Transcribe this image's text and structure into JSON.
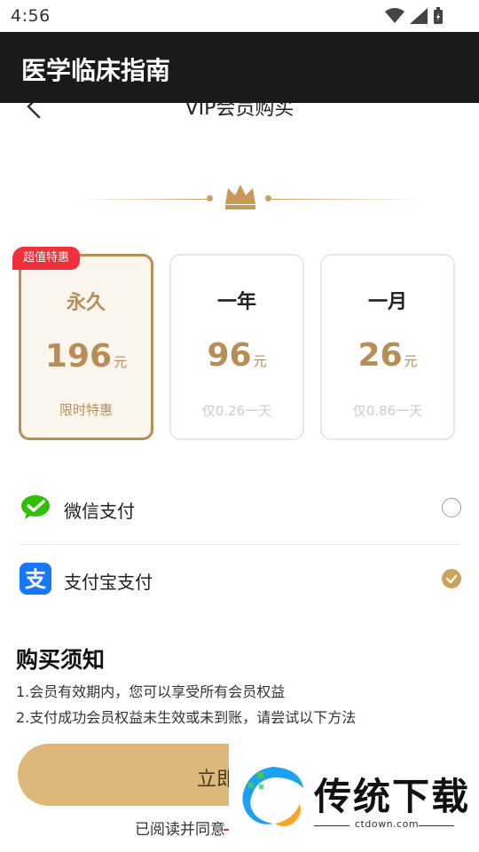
{
  "status_bar": {
    "time": "4:56"
  },
  "app_bar": {
    "title": "医学临床指南"
  },
  "page": {
    "title": "VIP会员购买"
  },
  "plans": [
    {
      "name": "永久",
      "price": "196",
      "unit": "元",
      "note": "限时特惠",
      "badge": "超值特惠",
      "selected": true
    },
    {
      "name": "一年",
      "price": "96",
      "unit": "元",
      "note": "仅0.26一天",
      "selected": false
    },
    {
      "name": "一月",
      "price": "26",
      "unit": "元",
      "note": "仅0.86一天",
      "selected": false
    }
  ],
  "payment": {
    "wechat": {
      "label": "微信支付",
      "checked": false
    },
    "alipay": {
      "label": "支付宝支付",
      "checked": true
    }
  },
  "notice": {
    "title": "购买须知",
    "lines": [
      "1.会员有效期内，您可以享受所有会员权益",
      "2.支付成功会员权益未生效或未到账，请尝试以下方法"
    ]
  },
  "buy_button": {
    "label": "立即"
  },
  "agreement": {
    "text": "已阅读并同意"
  },
  "watermark": {
    "brand": "传统下载",
    "domain": "ctdown.com"
  },
  "colors": {
    "gold": "#b98d56",
    "button": "#ddb87a",
    "badge_red": "#f0303a",
    "wechat_green": "#2dc100",
    "alipay_blue": "#1677ff",
    "app_bar": "#1a1a1a"
  },
  "icons": [
    "wifi-icon",
    "signal-icon",
    "battery-icon",
    "back-arrow-icon",
    "crown-icon",
    "wechat-pay-icon",
    "alipay-icon",
    "radio-unchecked-icon",
    "radio-checked-icon"
  ]
}
